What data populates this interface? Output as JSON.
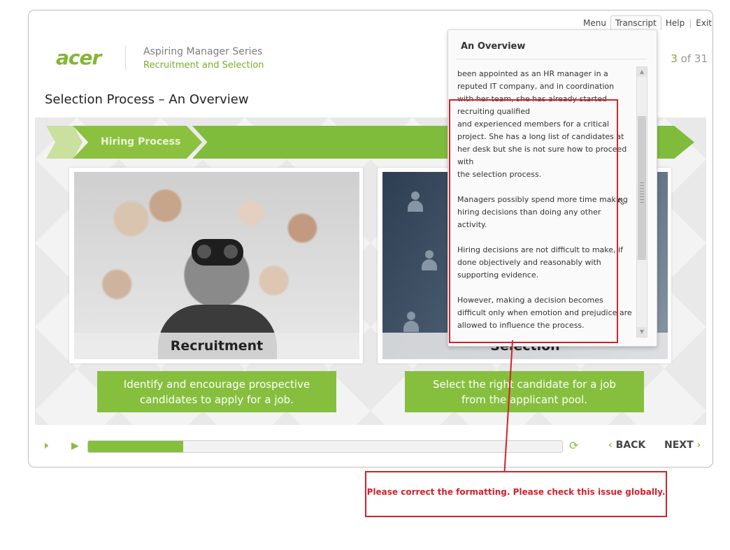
{
  "menu": {
    "items": [
      "Menu",
      "Transcript",
      "Help",
      "Exit"
    ],
    "active": "Transcript"
  },
  "brand": {
    "logo": "acer",
    "series": "Aspiring Manager Series",
    "course": "Recruitment and Selection"
  },
  "page": {
    "counter_current": "3",
    "counter_rest": " of 31",
    "title": "Selection Process – An Overview"
  },
  "process": {
    "step_label": "Hiring Process"
  },
  "cards": [
    {
      "caption": "Recruitment",
      "description": "Identify and encourage prospective candidates to apply for a job."
    },
    {
      "caption": "Selection",
      "description": "Select the right candidate for a job from the applicant pool."
    }
  ],
  "transcript": {
    "title": "An Overview",
    "paragraphs": [
      "been appointed as an HR manager in a reputed IT company, and in coordination with her team, she has already started recruiting qualified\nand experienced members for a critical project. She has a long list of candidates at her desk but she is not sure how to proceed with\nthe selection process.",
      "Managers possibly spend more time making hiring decisions than doing any other activity.",
      "Hiring decisions are not difficult to make, if done objectively and reasonably with supporting evidence.",
      "However, making a decision becomes difficult only when emotion and prejudice are allowed to influence the process."
    ]
  },
  "controls": {
    "volume_icon": "speaker-icon",
    "play_icon": "play-icon",
    "replay_icon": "replay-icon",
    "progress": 0.2,
    "back_label": "BACK",
    "next_label": "NEXT"
  },
  "review_comment": "Please correct the formatting. Please check this issue globally.",
  "colors": {
    "accent": "#86bf3e",
    "annotation": "#d0232a"
  }
}
